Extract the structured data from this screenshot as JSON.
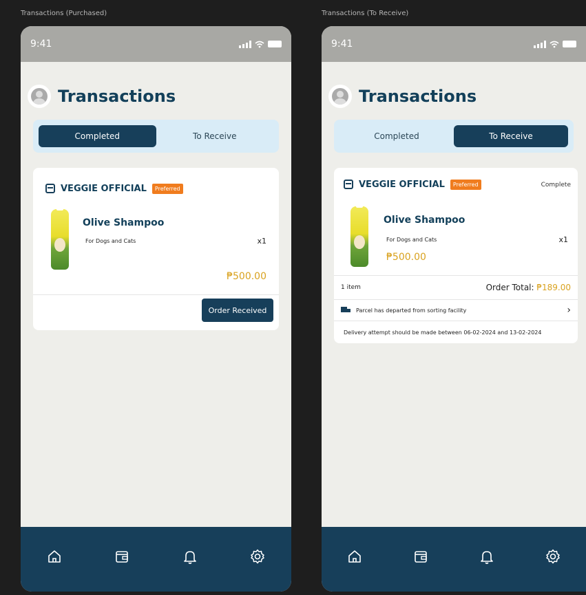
{
  "screens": [
    {
      "frame_label": "Transactions (Purchased)",
      "status_time": "9:41",
      "page_title": "Transactions",
      "tabs": [
        {
          "label": "Completed",
          "active": true
        },
        {
          "label": "To Receive",
          "active": false
        }
      ],
      "card": {
        "shop_name": "VEGGIE OFFICIAL",
        "badge": "Preferred",
        "product_name": "Olive Shampoo",
        "product_sub": "For Dogs and Cats",
        "quantity": "x1",
        "price": "₱500.00",
        "action_button": "Order Received"
      }
    },
    {
      "frame_label": "Transactions (To Receive)",
      "status_time": "9:41",
      "page_title": "Transactions",
      "tabs": [
        {
          "label": "Completed",
          "active": false
        },
        {
          "label": "To Receive",
          "active": true
        }
      ],
      "card": {
        "shop_name": "VEGGIE OFFICIAL",
        "badge": "Preferred",
        "status": "Complete",
        "product_name": "Olive Shampoo",
        "product_sub": "For Dogs and Cats",
        "quantity": "x1",
        "price": "₱500.00",
        "item_count": "1 item",
        "order_total_label": "Order Total:",
        "order_total_value": "₱189.00",
        "tracking_text": "Parcel has departed from sorting facility",
        "delivery_text": "Delivery attempt should be made between 06-02-2024 and 13-02-2024"
      }
    }
  ],
  "nav_items": [
    "home-icon",
    "wallet-icon",
    "bell-icon",
    "settings-icon"
  ],
  "colors": {
    "primary": "#173f5a",
    "accent_orange": "#f07c1e",
    "price_gold": "#d9a21f",
    "tab_bg": "#d9ecf7",
    "screen_bg": "#eeeeea"
  }
}
